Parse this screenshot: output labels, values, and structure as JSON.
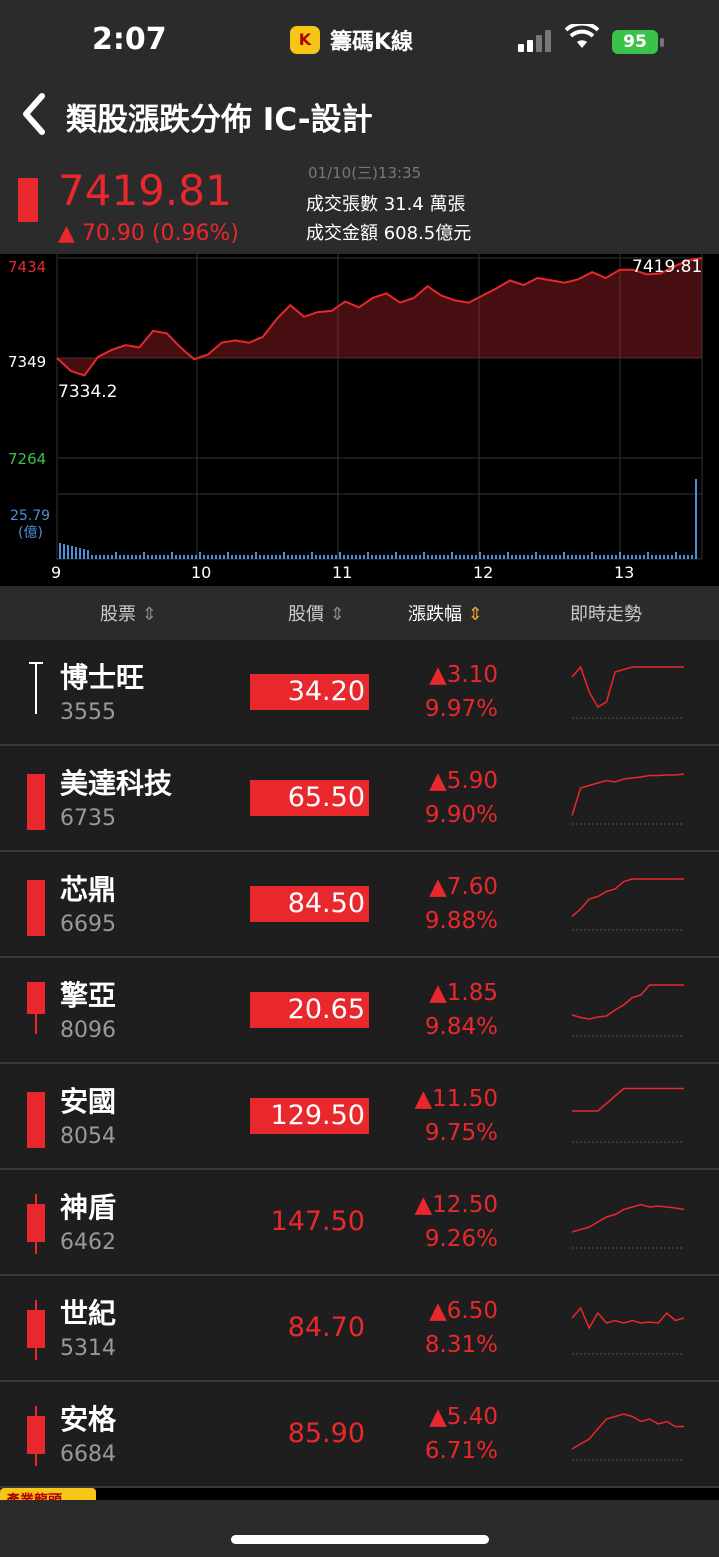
{
  "status": {
    "time": "2:07",
    "app_name": "籌碼K線",
    "battery": "95"
  },
  "header": {
    "title": "類股漲跌分佈  IC-設計"
  },
  "summary": {
    "price": "7419.81",
    "change": "▲ 70.90 (0.96%)",
    "datetime": "01/10(三)13:35",
    "volume_label": "成交張數  31.4 萬張",
    "amount_label": "成交金額  608.5億元"
  },
  "chart_data": {
    "type": "line",
    "y_top": "7434",
    "y_mid": "7349",
    "y_bottom": "7264",
    "last_value": "7419.81",
    "low_value": "7334.2",
    "vol_label": "25.79",
    "vol_unit": "(億)",
    "x_ticks": [
      "9",
      "10",
      "11",
      "12",
      "13"
    ],
    "ylim": [
      7264,
      7434
    ],
    "reference": 7349,
    "series": [
      7349,
      7338,
      7334.2,
      7350,
      7356,
      7360,
      7358,
      7372,
      7370,
      7358,
      7348,
      7352,
      7362,
      7364,
      7362,
      7367,
      7382,
      7394,
      7384,
      7388,
      7389,
      7397,
      7392,
      7400,
      7404,
      7396,
      7400,
      7410,
      7402,
      7398,
      7396,
      7402,
      7408,
      7415,
      7411,
      7417,
      7415,
      7413,
      7416,
      7422,
      7417,
      7424,
      7424,
      7420,
      7421,
      7427,
      7432,
      7434
    ]
  },
  "table": {
    "col_stock": "股票",
    "col_price": "股價",
    "col_change": "漲跌幅",
    "col_trend": "即時走勢",
    "sort_icon": "⇕"
  },
  "rows": [
    {
      "name": "博士旺",
      "code": "3555",
      "price": "34.20",
      "change": "▲3.10",
      "pct": "9.97%",
      "boxed": true,
      "candle": "doji"
    },
    {
      "name": "美達科技",
      "code": "6735",
      "price": "65.50",
      "change": "▲5.90",
      "pct": "9.90%",
      "boxed": true,
      "candle": "full"
    },
    {
      "name": "芯鼎",
      "code": "6695",
      "price": "84.50",
      "change": "▲7.60",
      "pct": "9.88%",
      "boxed": true,
      "candle": "full"
    },
    {
      "name": "擎亞",
      "code": "8096",
      "price": "20.65",
      "change": "▲1.85",
      "pct": "9.84%",
      "boxed": true,
      "candle": "lowwick"
    },
    {
      "name": "安國",
      "code": "8054",
      "price": "129.50",
      "change": "▲11.50",
      "pct": "9.75%",
      "boxed": true,
      "candle": "full"
    },
    {
      "name": "神盾",
      "code": "6462",
      "price": "147.50",
      "change": "▲12.50",
      "pct": "9.26%",
      "boxed": false,
      "candle": "wicks"
    },
    {
      "name": "世紀",
      "code": "5314",
      "price": "84.70",
      "change": "▲6.50",
      "pct": "8.31%",
      "boxed": false,
      "candle": "wicks"
    },
    {
      "name": "安格",
      "code": "6684",
      "price": "85.90",
      "change": "▲5.40",
      "pct": "6.71%",
      "boxed": false,
      "candle": "wicks"
    }
  ],
  "bottom_tag": "產業龍頭"
}
